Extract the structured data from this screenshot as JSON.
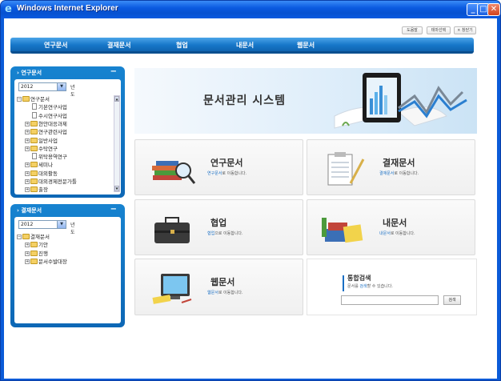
{
  "window": {
    "title": "Windows Internet Explorer",
    "controls": {
      "minimize": "_",
      "maximize": "□",
      "close": "✕"
    }
  },
  "util_buttons": [
    "도움말",
    "테마선택",
    "× 창닫기"
  ],
  "nav": [
    "연구문서",
    "결재문서",
    "협업",
    "내문서",
    "웹문서"
  ],
  "panels": {
    "research": {
      "title": "› 연구문서",
      "min": "−",
      "year": "2012",
      "year_suffix": "년도",
      "tree": [
        {
          "label": "연구문서",
          "type": "folder",
          "exp": "−",
          "level": 0
        },
        {
          "label": "기본연구사업",
          "type": "doc",
          "exp": "",
          "level": 1
        },
        {
          "label": "수시연구사업",
          "type": "doc",
          "exp": "",
          "level": 1
        },
        {
          "label": "현안대응과제",
          "type": "folder",
          "exp": "+",
          "level": 1
        },
        {
          "label": "연구관련사업",
          "type": "folder",
          "exp": "+",
          "level": 1
        },
        {
          "label": "일반사업",
          "type": "folder",
          "exp": "+",
          "level": 1
        },
        {
          "label": "수탁연구",
          "type": "folder",
          "exp": "+",
          "level": 1
        },
        {
          "label": "위탁용역연구",
          "type": "doc",
          "exp": "",
          "level": 1
        },
        {
          "label": "세미나",
          "type": "folder",
          "exp": "+",
          "level": 1
        },
        {
          "label": "대외활동",
          "type": "folder",
          "exp": "+",
          "level": 1
        },
        {
          "label": "대외경제전문가틀",
          "type": "folder",
          "exp": "+",
          "level": 1
        },
        {
          "label": "출장",
          "type": "folder",
          "exp": "+",
          "level": 1
        }
      ]
    },
    "approval": {
      "title": "› 결재문서",
      "min": "−",
      "year": "2012",
      "year_suffix": "년도",
      "tree": [
        {
          "label": "결재문서",
          "type": "folder",
          "exp": "−",
          "level": 0
        },
        {
          "label": "기안",
          "type": "folder",
          "exp": "+",
          "level": 1
        },
        {
          "label": "진행",
          "type": "folder",
          "exp": "+",
          "level": 1
        },
        {
          "label": "문서수발대장",
          "type": "folder",
          "exp": "+",
          "level": 1
        }
      ]
    }
  },
  "hero": {
    "title": "문서관리 시스템"
  },
  "cards": [
    {
      "title": "연구문서",
      "desc_hl": "연구문서",
      "desc_rest": "로 이동합니다.",
      "icon": "books-magnifier-icon"
    },
    {
      "title": "결재문서",
      "desc_hl": "결재문서",
      "desc_rest": "로 이동합니다.",
      "icon": "clipboard-icon"
    },
    {
      "title": "협업",
      "desc_hl": "협업",
      "desc_rest": "으로 이동합니다.",
      "icon": "briefcase-icon"
    },
    {
      "title": "내문서",
      "desc_hl": "내문서",
      "desc_rest": "로 이동합니다.",
      "icon": "stationery-icon"
    },
    {
      "title": "웹문서",
      "desc_hl": "웹문서",
      "desc_rest": "로 이동합니다.",
      "icon": "monitor-icon"
    }
  ],
  "search": {
    "title": "통합검색",
    "desc_pre": "문서를 ",
    "desc_hl": "검색",
    "desc_post": "할 수 있습니다.",
    "input_value": "",
    "button": "검색"
  }
}
